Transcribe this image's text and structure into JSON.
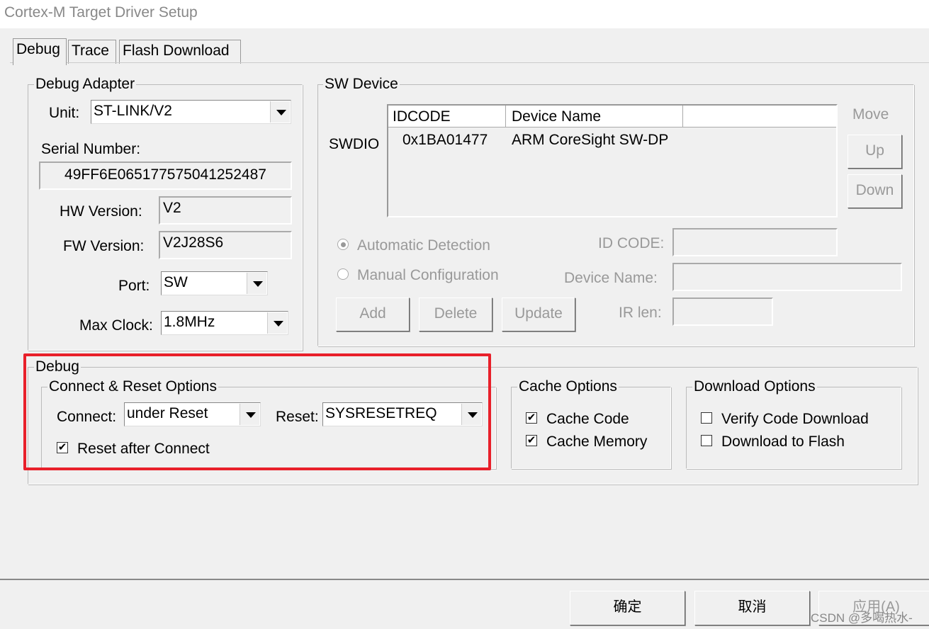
{
  "window": {
    "title": "Cortex-M Target Driver Setup"
  },
  "tabs": [
    {
      "label": "Debug",
      "active": true
    },
    {
      "label": "Trace"
    },
    {
      "label": "Flash Download"
    }
  ],
  "debug_adapter": {
    "title": "Debug Adapter",
    "unit_label": "Unit:",
    "unit_value": "ST-LINK/V2",
    "serial_label": "Serial Number:",
    "serial_value": "49FF6E065177575041252487",
    "hw_label": "HW Version:",
    "hw_value": "V2",
    "fw_label": "FW Version:",
    "fw_value": "V2J28S6",
    "port_label": "Port:",
    "port_value": "SW",
    "clock_label": "Max Clock:",
    "clock_value": "1.8MHz"
  },
  "sw_device": {
    "title": "SW Device",
    "row_label": "SWDIO",
    "columns": [
      "IDCODE",
      "Device Name"
    ],
    "rows": [
      [
        "0x1BA01477",
        "ARM CoreSight SW-DP"
      ]
    ],
    "move_label": "Move",
    "up": "Up",
    "down": "Down",
    "auto_detect": "Automatic Detection",
    "manual_config": "Manual Configuration",
    "add": "Add",
    "delete": "Delete",
    "update": "Update",
    "idcode_label": "ID CODE:",
    "device_name_label": "Device Name:",
    "irlen_label": "IR len:"
  },
  "debug": {
    "title": "Debug",
    "connect_reset": {
      "title": "Connect & Reset Options",
      "connect_label": "Connect:",
      "connect_value": "under Reset",
      "reset_label": "Reset:",
      "reset_value": "SYSRESETREQ",
      "reset_after_connect": "Reset after Connect",
      "reset_after_connect_checked": true
    },
    "cache": {
      "title": "Cache Options",
      "cache_code": "Cache Code",
      "cache_code_checked": true,
      "cache_memory": "Cache Memory",
      "cache_memory_checked": true
    },
    "download": {
      "title": "Download Options",
      "verify": "Verify Code Download",
      "verify_checked": false,
      "to_flash": "Download to Flash",
      "to_flash_checked": false
    }
  },
  "footer": {
    "ok": "确定",
    "cancel": "取消",
    "apply": "应用(A)"
  },
  "watermark": "CSDN @多喝热水-",
  "highlight_color": "#e8202a"
}
